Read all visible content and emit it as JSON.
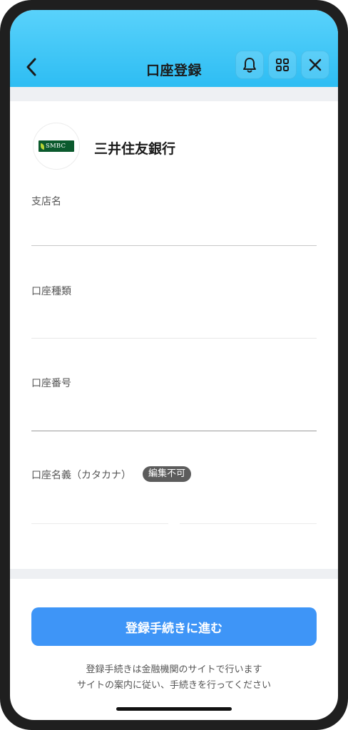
{
  "header": {
    "title": "口座登録",
    "icons": [
      "chevron-left-icon",
      "bell-icon",
      "grid-icon",
      "close-icon"
    ]
  },
  "bank": {
    "logo_text": "SMBC",
    "name": "三井住友銀行"
  },
  "fields": {
    "branch_label": "支店名",
    "account_type_label": "口座種類",
    "account_number_label": "口座番号",
    "holder_label": "口座名義（カタカナ）",
    "holder_badge": "編集不可"
  },
  "footer": {
    "submit_label": "登録手続きに進む",
    "note_line1": "登録手続きは金融機関のサイトで行います",
    "note_line2": "サイトの案内に従い、手続きを行ってください"
  },
  "colors": {
    "header_top": "#59d2fb",
    "header_bottom": "#2ebdf3",
    "button": "#3e95f7",
    "badge": "#5c5c5c"
  }
}
